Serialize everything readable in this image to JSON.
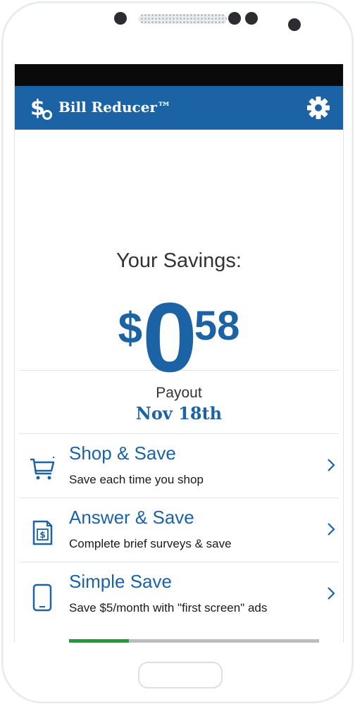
{
  "app": {
    "title": "Bill Reducer™"
  },
  "savings": {
    "label": "Your Savings:",
    "currency": "$",
    "dollars": "0",
    "cents": "58"
  },
  "payout": {
    "label": "Payout",
    "date": "Nov 18th"
  },
  "menu": [
    {
      "title": "Shop & Save",
      "subtitle": "Save each time you shop",
      "icon": "shopping-cart-icon"
    },
    {
      "title": "Answer & Save",
      "subtitle": "Complete brief surveys & save",
      "icon": "survey-document-icon"
    },
    {
      "title": "Simple Save",
      "subtitle": "Save $5/month with \"first screen\" ads",
      "icon": "smartphone-icon",
      "progress": 0.24
    }
  ],
  "colors": {
    "brand": "#1b63a4",
    "progress": "#1e9b3a",
    "statusbar": "#0a0a0a"
  }
}
